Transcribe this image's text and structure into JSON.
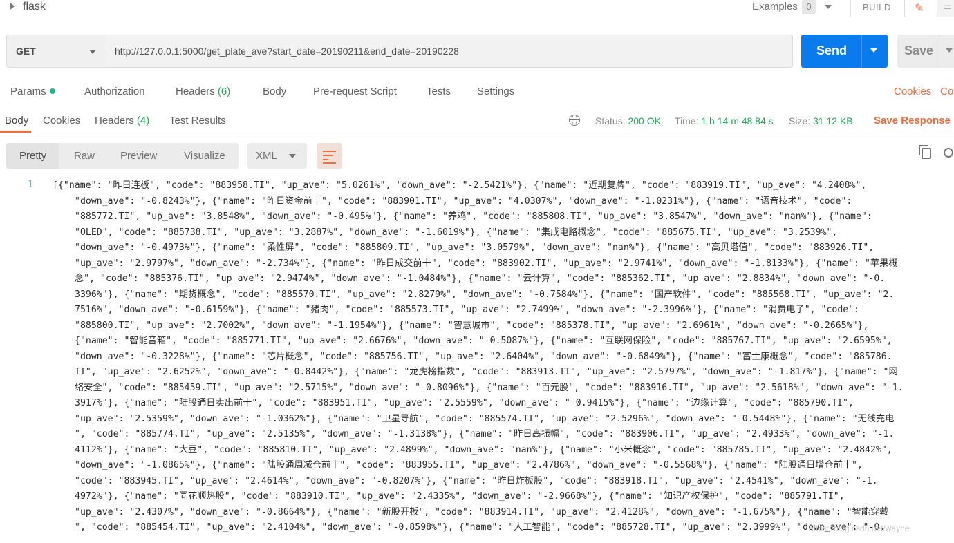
{
  "header": {
    "collection_name": "flask",
    "examples_label": "Examples",
    "examples_count": "0",
    "build_label": "BUILD"
  },
  "request": {
    "method": "GET",
    "url": "http://127.0.0.1:5000/get_plate_ave?start_date=20190211&end_date=20190228",
    "send_label": "Send",
    "save_label": "Save"
  },
  "request_tabs": {
    "params": "Params",
    "authorization": "Authorization",
    "headers": "Headers",
    "headers_count": "(6)",
    "body": "Body",
    "prerequest": "Pre-request Script",
    "tests": "Tests",
    "settings": "Settings",
    "cookies": "Cookies",
    "code": "Co"
  },
  "response": {
    "tabs": {
      "body": "Body",
      "cookies": "Cookies",
      "headers": "Headers",
      "headers_count": "(4)",
      "test_results": "Test Results"
    },
    "status_label": "Status:",
    "status_value": "200 OK",
    "time_label": "Time:",
    "time_value": "1 h 14 m 48.84 s",
    "size_label": "Size:",
    "size_value": "31.12 KB",
    "save_response": "Save Response"
  },
  "view": {
    "pretty": "Pretty",
    "raw": "Raw",
    "preview": "Preview",
    "visualize": "Visualize",
    "format": "XML"
  },
  "code": {
    "line_number": "1",
    "lines": [
      "[{\"name\": \"昨日连板\", \"code\": \"883958.TI\", \"up_ave\": \"5.0261%\", \"down_ave\": \"-2.5421%\"}, {\"name\": \"近期复牌\", \"code\": \"883919.TI\", \"up_ave\": \"4.2408%\",",
      "\"down_ave\": \"-0.8243%\"}, {\"name\": \"昨日资金前十\", \"code\": \"883901.TI\", \"up_ave\": \"4.0307%\", \"down_ave\": \"-1.0231%\"}, {\"name\": \"语音技术\", \"code\":",
      "\"885772.TI\", \"up_ave\": \"3.8548%\", \"down_ave\": \"-0.495%\"}, {\"name\": \"养鸡\", \"code\": \"885808.TI\", \"up_ave\": \"3.8547%\", \"down_ave\": \"nan%\"}, {\"name\":",
      "\"OLED\", \"code\": \"885738.TI\", \"up_ave\": \"3.2887%\", \"down_ave\": \"-1.6019%\"}, {\"name\": \"集成电路概念\", \"code\": \"885675.TI\", \"up_ave\": \"3.2539%\",",
      "\"down_ave\": \"-0.4973%\"}, {\"name\": \"柔性屏\", \"code\": \"885809.TI\", \"up_ave\": \"3.0579%\", \"down_ave\": \"nan%\"}, {\"name\": \"高贝塔值\", \"code\": \"883926.TI\",",
      "\"up_ave\": \"2.9797%\", \"down_ave\": \"-2.734%\"}, {\"name\": \"昨日成交前十\", \"code\": \"883902.TI\", \"up_ave\": \"2.9741%\", \"down_ave\": \"-1.8133%\"}, {\"name\": \"苹果概",
      "念\", \"code\": \"885376.TI\", \"up_ave\": \"2.9474%\", \"down_ave\": \"-1.0484%\"}, {\"name\": \"云计算\", \"code\": \"885362.TI\", \"up_ave\": \"2.8834%\", \"down_ave\": \"-0.",
      "3396%\"}, {\"name\": \"期货概念\", \"code\": \"885570.TI\", \"up_ave\": \"2.8279%\", \"down_ave\": \"-0.7584%\"}, {\"name\": \"国产软件\", \"code\": \"885568.TI\", \"up_ave\": \"2.",
      "7516%\", \"down_ave\": \"-0.6159%\"}, {\"name\": \"猪肉\", \"code\": \"885573.TI\", \"up_ave\": \"2.7499%\", \"down_ave\": \"-2.3996%\"}, {\"name\": \"消费电子\", \"code\":",
      "\"885800.TI\", \"up_ave\": \"2.7002%\", \"down_ave\": \"-1.1954%\"}, {\"name\": \"智慧城市\", \"code\": \"885378.TI\", \"up_ave\": \"2.6961%\", \"down_ave\": \"-0.2665%\"},",
      "{\"name\": \"智能音箱\", \"code\": \"885771.TI\", \"up_ave\": \"2.6676%\", \"down_ave\": \"-0.5087%\"}, {\"name\": \"互联网保险\", \"code\": \"885767.TI\", \"up_ave\": \"2.6595%\",",
      "\"down_ave\": \"-0.3228%\"}, {\"name\": \"芯片概念\", \"code\": \"885756.TI\", \"up_ave\": \"2.6404%\", \"down_ave\": \"-0.6849%\"}, {\"name\": \"富士康概念\", \"code\": \"885786.",
      "TI\", \"up_ave\": \"2.6252%\", \"down_ave\": \"-0.8442%\"}, {\"name\": \"龙虎榜指数\", \"code\": \"883913.TI\", \"up_ave\": \"2.5797%\", \"down_ave\": \"-1.817%\"}, {\"name\": \"网",
      "络安全\", \"code\": \"885459.TI\", \"up_ave\": \"2.5715%\", \"down_ave\": \"-0.8096%\"}, {\"name\": \"百元股\", \"code\": \"883916.TI\", \"up_ave\": \"2.5618%\", \"down_ave\": \"-1.",
      "3917%\"}, {\"name\": \"陆股通日卖出前十\", \"code\": \"883951.TI\", \"up_ave\": \"2.5559%\", \"down_ave\": \"-0.9415%\"}, {\"name\": \"边缘计算\", \"code\": \"885790.TI\",",
      "\"up_ave\": \"2.5359%\", \"down_ave\": \"-1.0362%\"}, {\"name\": \"卫星导航\", \"code\": \"885574.TI\", \"up_ave\": \"2.5296%\", \"down_ave\": \"-0.5448%\"}, {\"name\": \"无线充电",
      "\", \"code\": \"885774.TI\", \"up_ave\": \"2.5135%\", \"down_ave\": \"-1.3138%\"}, {\"name\": \"昨日高振幅\", \"code\": \"883906.TI\", \"up_ave\": \"2.4933%\", \"down_ave\": \"-1.",
      "4112%\"}, {\"name\": \"大豆\", \"code\": \"885810.TI\", \"up_ave\": \"2.4899%\", \"down_ave\": \"nan%\"}, {\"name\": \"小米概念\", \"code\": \"885785.TI\", \"up_ave\": \"2.4842%\",",
      "\"down_ave\": \"-1.0865%\"}, {\"name\": \"陆股通周减仓前十\", \"code\": \"883955.TI\", \"up_ave\": \"2.4786%\", \"down_ave\": \"-0.5568%\"}, {\"name\": \"陆股通日增仓前十\",",
      "\"code\": \"883945.TI\", \"up_ave\": \"2.4614%\", \"down_ave\": \"-0.8207%\"}, {\"name\": \"昨日炸板股\", \"code\": \"883918.TI\", \"up_ave\": \"2.4541%\", \"down_ave\": \"-1.",
      "4972%\"}, {\"name\": \"同花顺热股\", \"code\": \"883910.TI\", \"up_ave\": \"2.4335%\", \"down_ave\": \"-2.9668%\"}, {\"name\": \"知识产权保护\", \"code\": \"885791.TI\",",
      "\"up_ave\": \"2.4307%\", \"down_ave\": \"-0.8664%\"}, {\"name\": \"新股开板\", \"code\": \"883914.TI\", \"up_ave\": \"2.4128%\", \"down_ave\": \"-1.675%\"}, {\"name\": \"智能穿戴",
      "\", \"code\": \"885454.TI\", \"up_ave\": \"2.4104%\", \"down_ave\": \"-0.8598%\"}, {\"name\": \"人工智能\", \"code\": \"885728.TI\", \"up_ave\": \"2.3999%\", \"down_ave\": \"-0."
    ]
  },
  "watermark": "https://blog.csdn.net/wayhe"
}
